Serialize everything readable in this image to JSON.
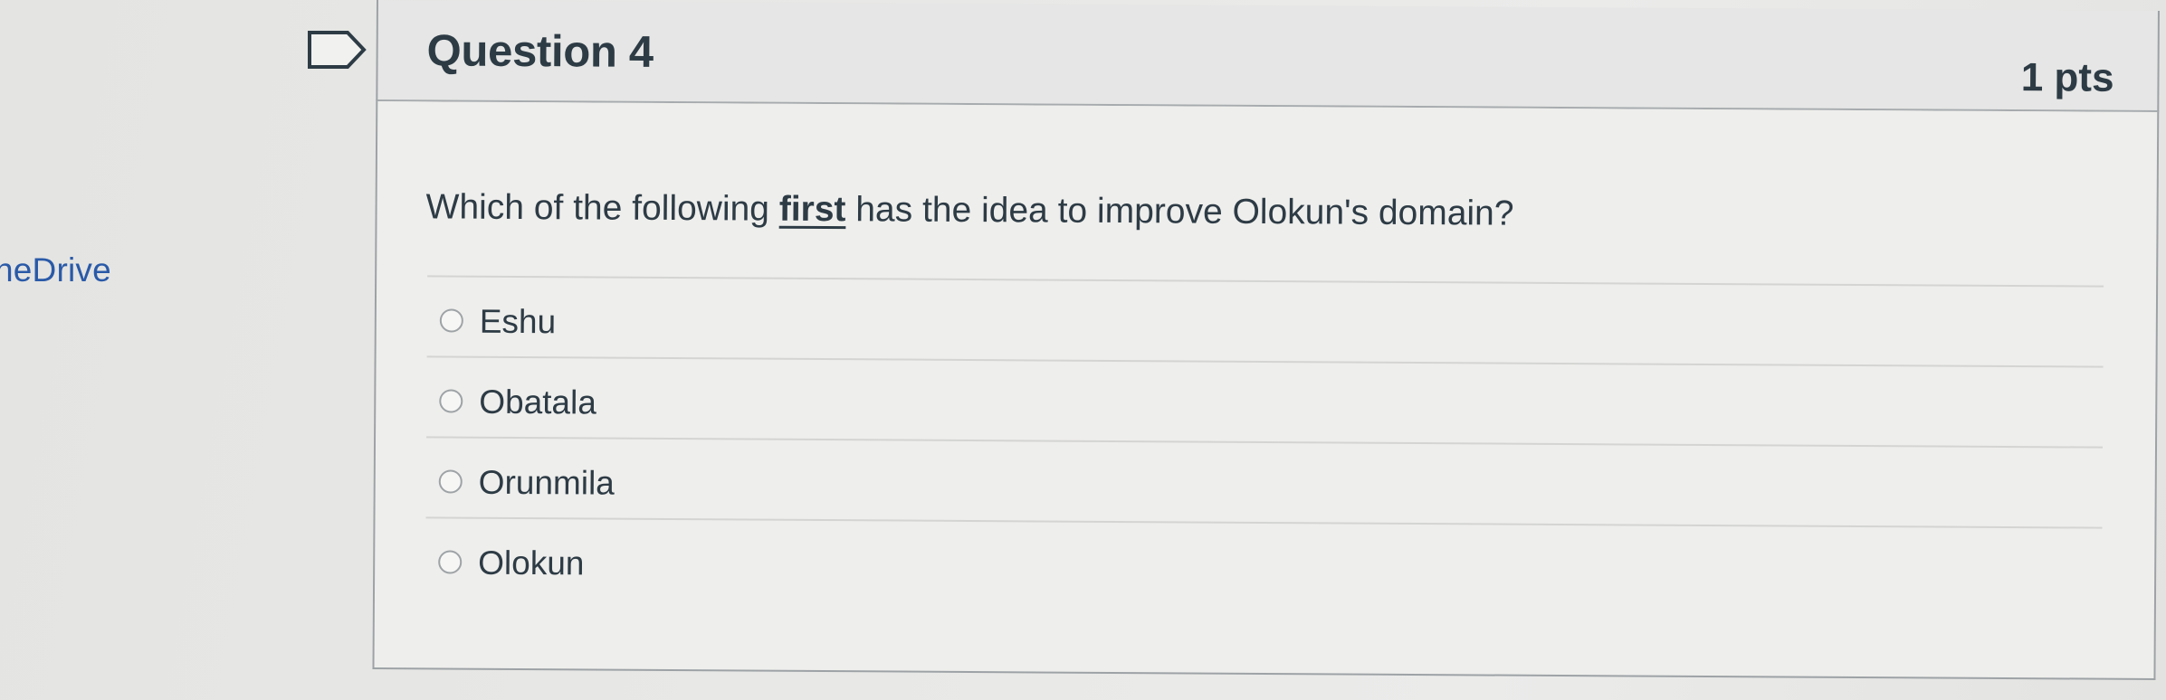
{
  "sidebar": {
    "link_label": "neDrive"
  },
  "question": {
    "title": "Question 4",
    "points": "1 pts",
    "text_before": "Which of the following ",
    "text_emphasis": "first",
    "text_after": " has the idea to improve Olokun's domain?",
    "answers": [
      {
        "label": "Eshu"
      },
      {
        "label": "Obatala"
      },
      {
        "label": "Orunmila"
      },
      {
        "label": "Olokun"
      }
    ]
  },
  "icons": {
    "flag": "flag-icon",
    "radio": "radio-button"
  },
  "colors": {
    "link": "#2a5aa8",
    "text": "#2d3b45",
    "header_bg": "#e5e6e5",
    "body_bg": "#eeeeec"
  }
}
